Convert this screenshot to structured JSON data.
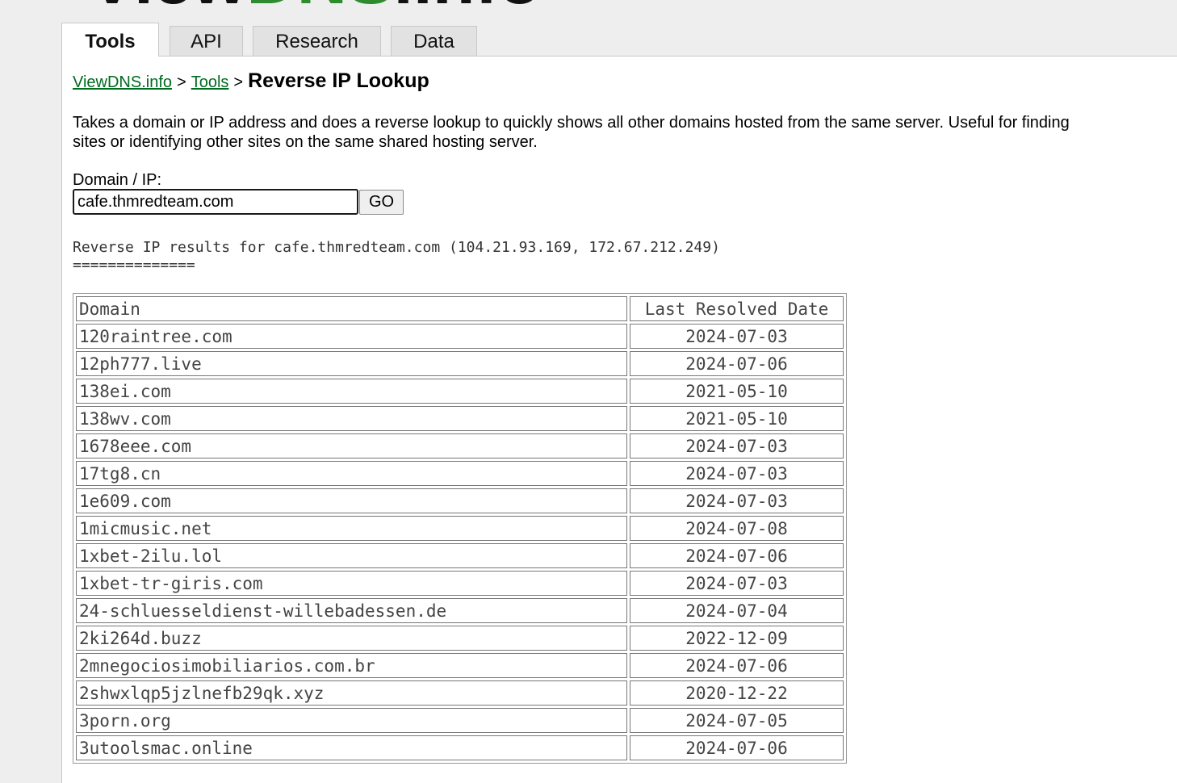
{
  "logo": {
    "text": "ViewDNS.info",
    "colors": {
      "dark": "#111111",
      "green": "#2e8b2e"
    }
  },
  "tabs": [
    {
      "label": "Tools",
      "active": true
    },
    {
      "label": "API",
      "active": false
    },
    {
      "label": "Research",
      "active": false
    },
    {
      "label": "Data",
      "active": false
    }
  ],
  "breadcrumb": {
    "home": "ViewDNS.info",
    "separator": ">",
    "tools": "Tools",
    "current": "Reverse IP Lookup"
  },
  "description": {
    "line1": "Takes a domain or IP address and does a reverse lookup to quickly shows all other domains hosted from the same server. Useful for finding",
    "line2": "sites or identifying other sites on the same shared hosting server."
  },
  "form": {
    "label": "Domain / IP:",
    "value": "cafe.thmredteam.com",
    "button": "GO"
  },
  "results": {
    "title": "Reverse IP results for cafe.thmredteam.com (104.21.93.169, 172.67.212.249)",
    "rule": "==============",
    "headers": {
      "domain": "Domain",
      "date": "Last Resolved Date"
    },
    "rows": [
      {
        "domain": "120raintree.com",
        "date": "2024-07-03"
      },
      {
        "domain": "12ph777.live",
        "date": "2024-07-06"
      },
      {
        "domain": "138ei.com",
        "date": "2021-05-10"
      },
      {
        "domain": "138wv.com",
        "date": "2021-05-10"
      },
      {
        "domain": "1678eee.com",
        "date": "2024-07-03"
      },
      {
        "domain": "17tg8.cn",
        "date": "2024-07-03"
      },
      {
        "domain": "1e609.com",
        "date": "2024-07-03"
      },
      {
        "domain": "1micmusic.net",
        "date": "2024-07-08"
      },
      {
        "domain": "1xbet-2ilu.lol",
        "date": "2024-07-06"
      },
      {
        "domain": "1xbet-tr-giris.com",
        "date": "2024-07-03"
      },
      {
        "domain": "24-schluesseldienst-willebadessen.de",
        "date": "2024-07-04"
      },
      {
        "domain": "2ki264d.buzz",
        "date": "2022-12-09"
      },
      {
        "domain": "2mnegociosimobiliarios.com.br",
        "date": "2024-07-06"
      },
      {
        "domain": "2shwxlqp5jzlnefb29qk.xyz",
        "date": "2020-12-22"
      },
      {
        "domain": "3porn.org",
        "date": "2024-07-05"
      },
      {
        "domain": "3utoolsmac.online",
        "date": "2024-07-06"
      }
    ]
  }
}
